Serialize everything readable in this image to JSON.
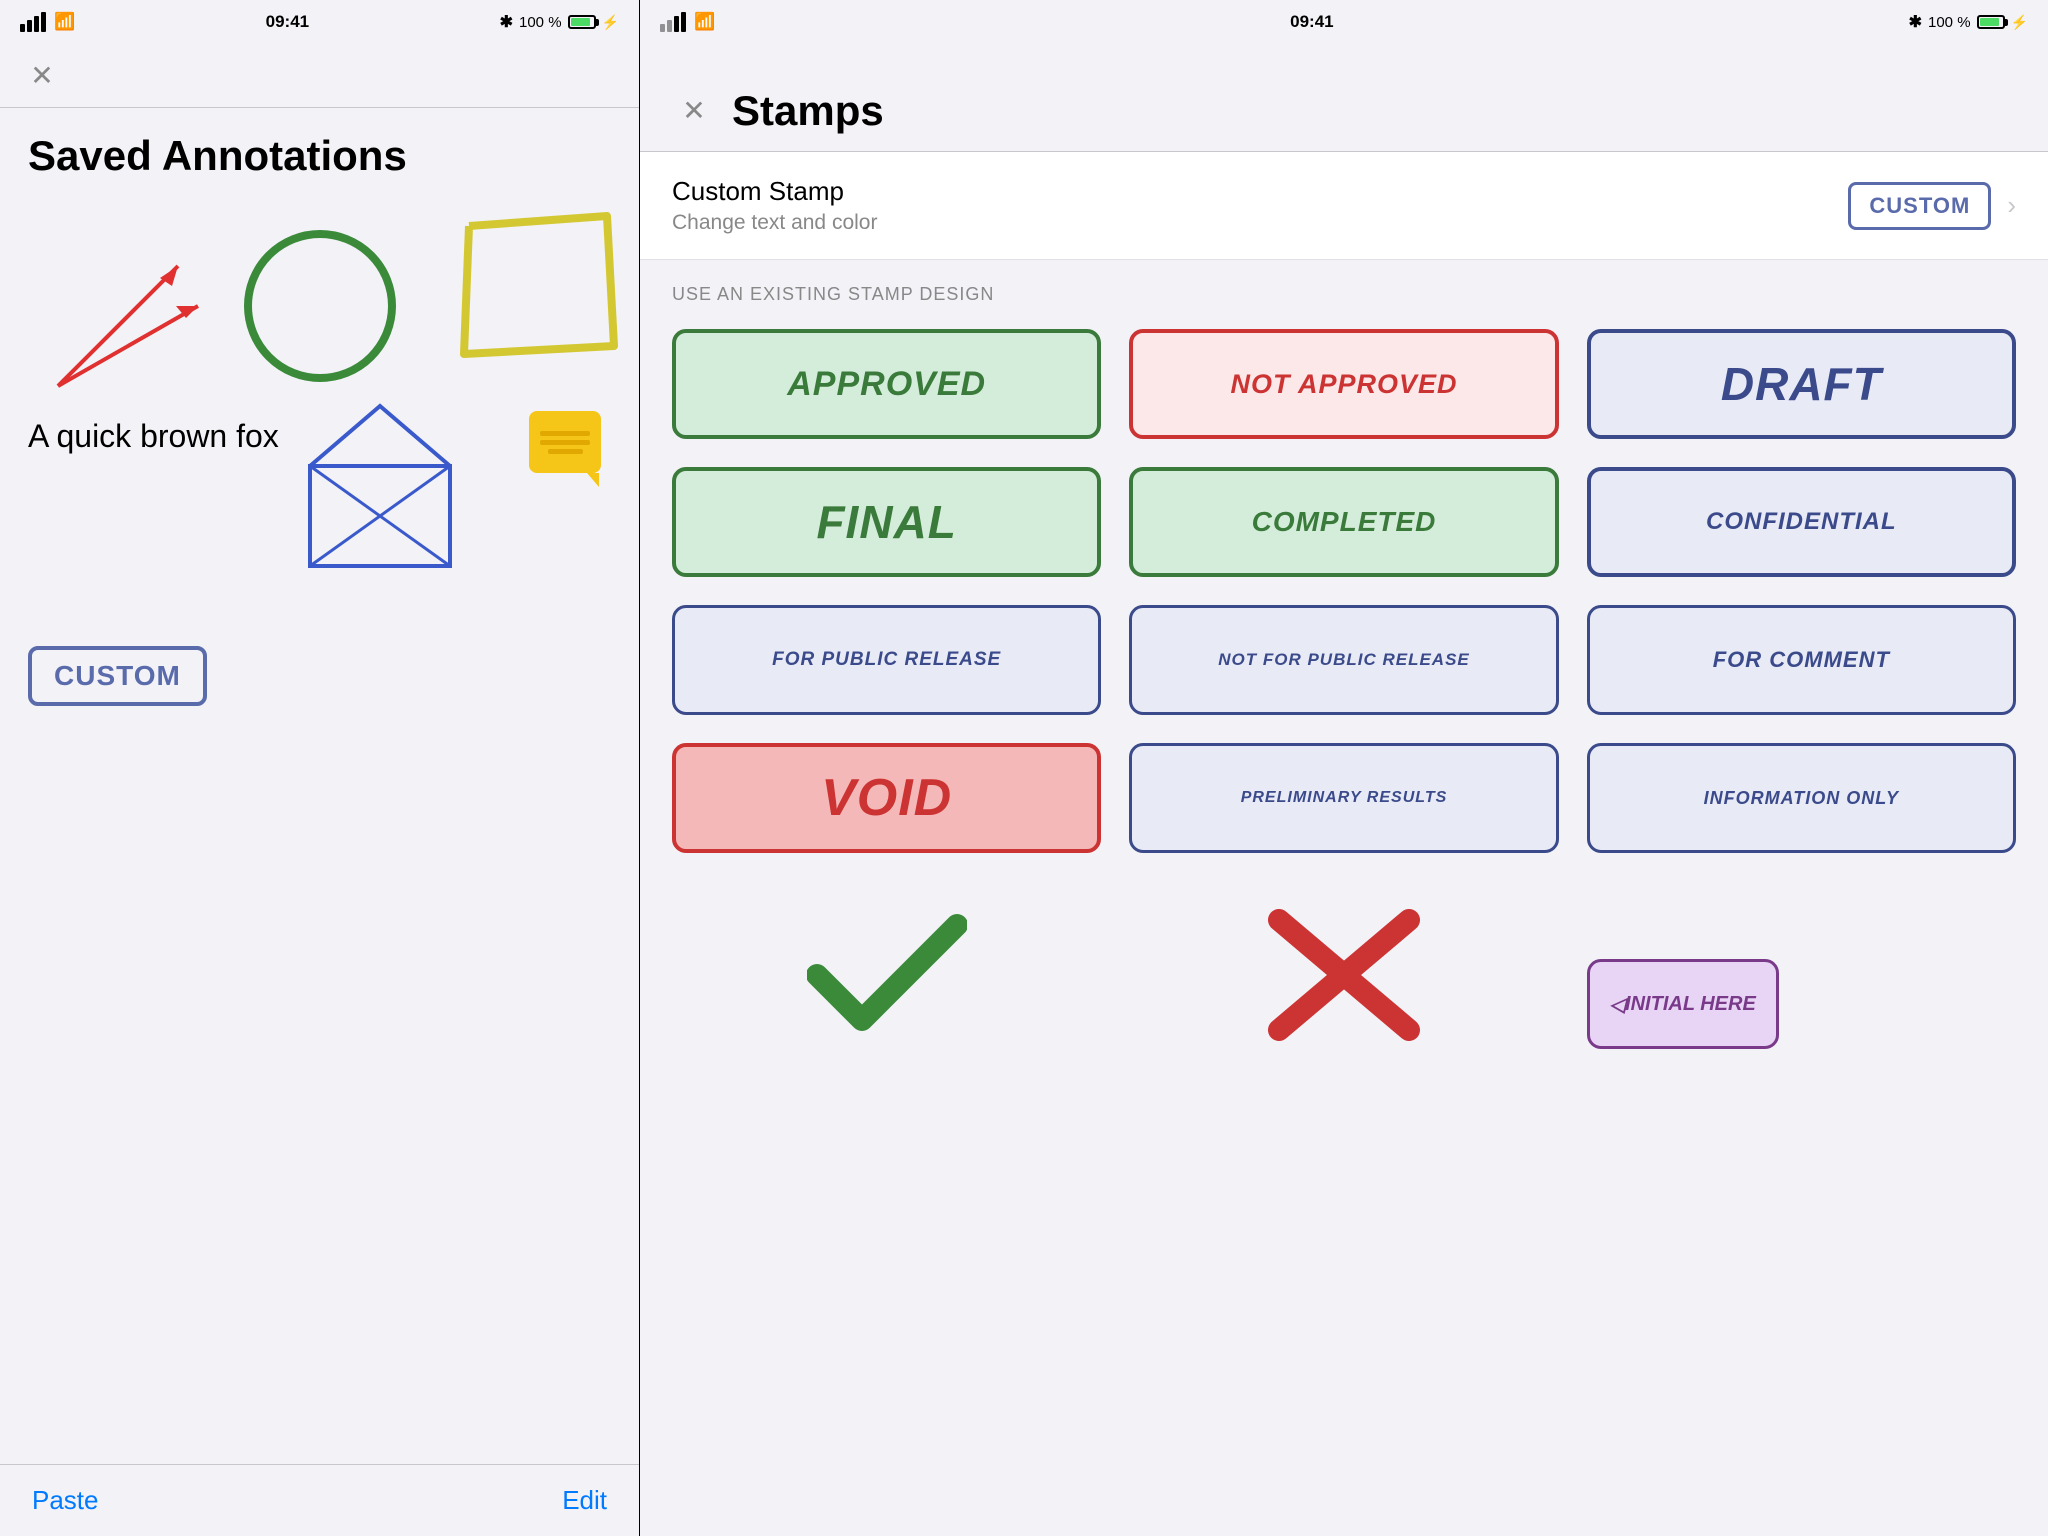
{
  "left": {
    "status": {
      "time": "09:41",
      "battery": "100 %",
      "bluetooth": "✱"
    },
    "title": "Saved Annotations",
    "annotations": {
      "text": "A quick brown fox"
    },
    "custom_stamp": "CUSTOM",
    "bottom": {
      "paste": "Paste",
      "edit": "Edit"
    }
  },
  "right": {
    "status": {
      "time": "09:41",
      "battery": "100 %",
      "bluetooth": "✱"
    },
    "title": "Stamps",
    "custom_stamp_section": {
      "title": "Custom Stamp",
      "subtitle": "Change text and color",
      "preview": "CUSTOM"
    },
    "section_header": "USE AN EXISTING STAMP DESIGN",
    "stamps": [
      {
        "id": "approved",
        "label": "APPROVED",
        "style": "approved"
      },
      {
        "id": "not-approved",
        "label": "NOT APPROVED",
        "style": "not-approved"
      },
      {
        "id": "draft",
        "label": "DRAFT",
        "style": "draft"
      },
      {
        "id": "final",
        "label": "FINAL",
        "style": "final"
      },
      {
        "id": "completed",
        "label": "COMPLETED",
        "style": "completed"
      },
      {
        "id": "confidential",
        "label": "CONFIDENTIAL",
        "style": "confidential"
      },
      {
        "id": "for-public-release",
        "label": "FOR PUBLIC RELEASE",
        "style": "for-public-release"
      },
      {
        "id": "not-for-public-release",
        "label": "NOT FOR PUBLIC RELEASE",
        "style": "not-for-public-release"
      },
      {
        "id": "for-comment",
        "label": "FOR COMMENT",
        "style": "for-comment"
      },
      {
        "id": "void",
        "label": "VOID",
        "style": "void"
      },
      {
        "id": "preliminary-results",
        "label": "PRELIMINARY RESULTS",
        "style": "preliminary-results"
      },
      {
        "id": "information-only",
        "label": "INFORMATION ONLY",
        "style": "information-only"
      }
    ],
    "bottom_stamps": {
      "initial_here": "INITIAL HERE"
    }
  }
}
